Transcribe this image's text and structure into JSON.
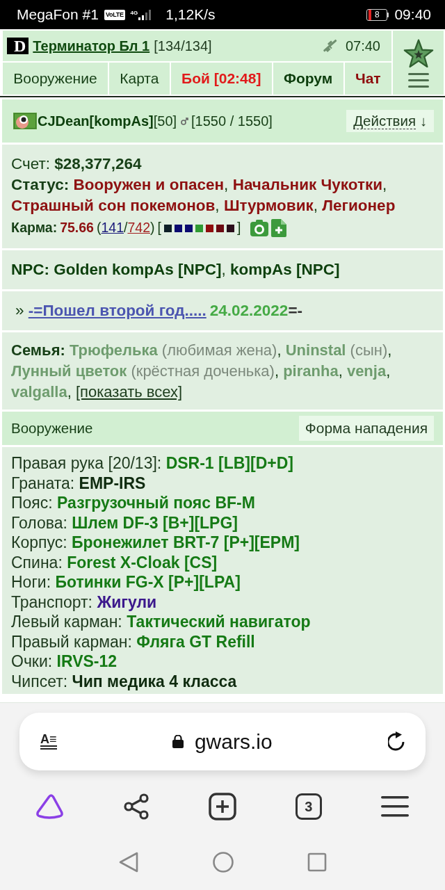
{
  "status_bar": {
    "carrier": "MegaFon #1",
    "volte": "VoLTE",
    "network": "4G",
    "speed": "1,12K/s",
    "battery": "8",
    "time": "09:40"
  },
  "header": {
    "logo": "D",
    "title": "Терминатор Бл 1",
    "hp": "[134/134]",
    "clock": "07:40"
  },
  "nav_tabs": [
    {
      "label": "Вооружение",
      "kind": "plain"
    },
    {
      "label": "Карта",
      "kind": "plain"
    },
    {
      "label": "Бой [02:48]",
      "kind": "alert"
    },
    {
      "label": "Форум",
      "kind": "bold"
    },
    {
      "label": "Чат",
      "kind": "chat"
    }
  ],
  "profile": {
    "name": "CJDean[kompAs]",
    "level": "[50]",
    "hp": "[1550 / 1550]",
    "actions": {
      "label": "Действия",
      "arrow": "↓"
    }
  },
  "account": {
    "label": "Счет:",
    "value": "$28,377,264"
  },
  "status": {
    "label": "Статус:",
    "items": [
      {
        "text": "Вооружен и опасен",
        "after": ","
      },
      {
        "text": "Начальник Чукотки",
        "after": ","
      },
      {
        "text": "Страшный сон покемонов",
        "after": ","
      },
      {
        "text": "Штурмовик",
        "after": ","
      },
      {
        "text": "Легионер"
      }
    ]
  },
  "karma": {
    "label": "Карма:",
    "value": "75.66",
    "open": "(",
    "plus": "141",
    "slash": "/",
    "minus": "742",
    "close": ")",
    "bracket_open": "[",
    "swatches": [
      {
        "color": "#0e1f27"
      },
      {
        "color": "#0b0b70"
      },
      {
        "color": "#0b0b70"
      },
      {
        "color": "#2f9a33"
      },
      {
        "color": "#8f0d0d"
      },
      {
        "color": "#6c0a12"
      },
      {
        "color": "#2b0e1b"
      }
    ],
    "bracket_close": "]"
  },
  "npc": {
    "label": "NPC:",
    "items": [
      {
        "name": "Golden kompAs [NPC]",
        "after": ","
      },
      {
        "name": "kompAs [NPC]"
      }
    ]
  },
  "clan": {
    "marker": "»",
    "link": "-=Пошел второй год.....",
    "date": "24.02.2022",
    "suffix": "=-"
  },
  "family": {
    "label": "Семья:",
    "members": [
      {
        "name": "Трюфелька",
        "relation": "(любимая жена)",
        "after": ","
      },
      {
        "name": "Uninstal",
        "relation": "(сын)",
        "after": ","
      },
      {
        "name": "Лунный цветок",
        "relation": "(крёстная доченька)",
        "after": ","
      },
      {
        "name": "piranha",
        "after": ","
      },
      {
        "name": "venja",
        "after": ","
      },
      {
        "name": "valgalla",
        "after": ","
      }
    ],
    "show_all": "[показать всех]"
  },
  "armament": {
    "title": "Вооружение",
    "button": "Форма нападения",
    "items": [
      {
        "slot": "Правая рука [20/13]:",
        "item": "DSR-1 [LB][D+D]",
        "kind": "gear"
      },
      {
        "slot": "Граната:",
        "item": "EMP-IRS",
        "kind": "plain"
      },
      {
        "slot": "Пояс:",
        "item": "Разгрузочный пояс BF-M",
        "kind": "gear"
      },
      {
        "slot": "Голова:",
        "item": "Шлем DF-3 [B+][LPG]",
        "kind": "gear"
      },
      {
        "slot": "Корпус:",
        "item": "Бронежилет BRT-7 [P+][EPM]",
        "kind": "gear"
      },
      {
        "slot": "Спина:",
        "item": "Forest X-Cloak [CS]",
        "kind": "gear"
      },
      {
        "slot": "Ноги:",
        "item": "Ботинки FG-X [P+][LPA]",
        "kind": "gear"
      },
      {
        "slot": "Транспорт:",
        "item": "Жигули",
        "kind": "vehicle"
      },
      {
        "slot": "Левый карман:",
        "item": "Тактический навигатор",
        "kind": "gear"
      },
      {
        "slot": "Правый карман:",
        "item": "Фляга GT Refill",
        "kind": "gear"
      },
      {
        "slot": "Очки:",
        "item": "IRVS-12",
        "kind": "gear"
      },
      {
        "slot": "Чипсет:",
        "item": "Чип медика 4 класса",
        "kind": "plain"
      }
    ]
  },
  "browser": {
    "reader": "A≡",
    "url": "gwars.io",
    "tabs": "3"
  }
}
